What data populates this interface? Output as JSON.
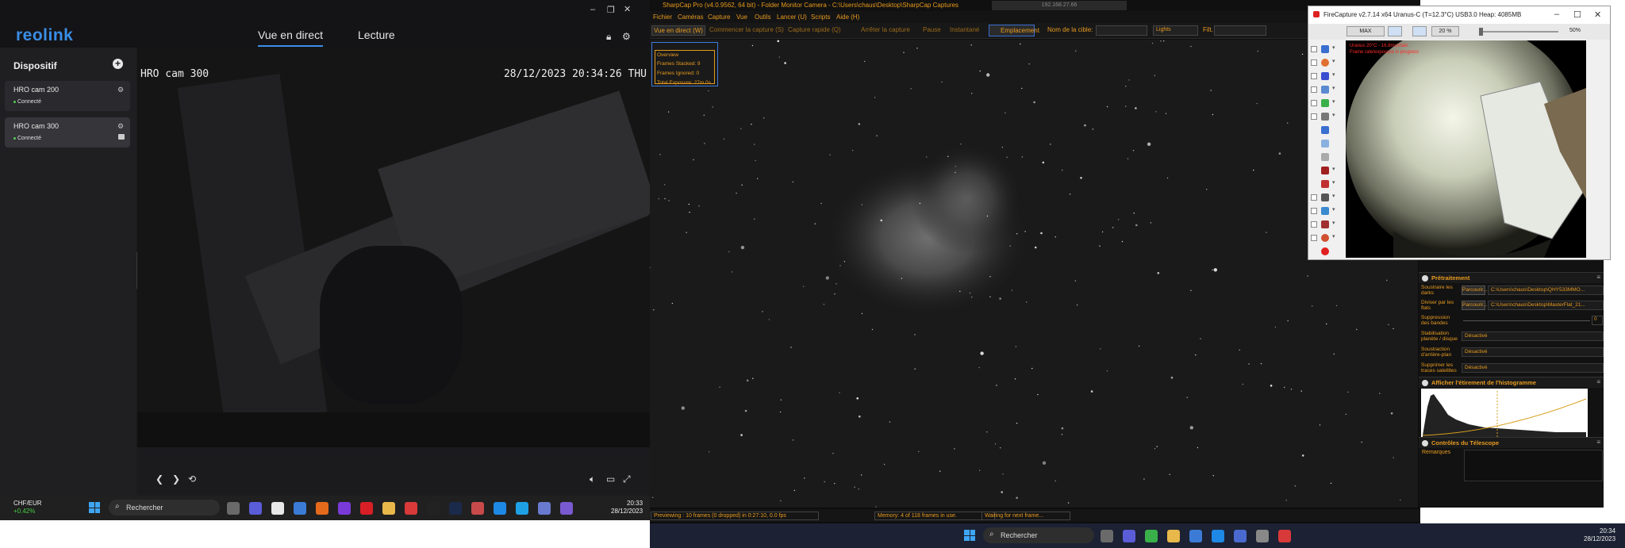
{
  "reolink": {
    "tabs": [
      "Vue en direct",
      "Lecture"
    ],
    "sidebar_title": "Dispositif",
    "cameras": [
      {
        "name": "HRO cam 200",
        "status": "Connecté"
      },
      {
        "name": "HRO cam 300",
        "status": "Connecté"
      }
    ],
    "osd_name": "HRO cam 300",
    "osd_time": "28/12/2023 20:34:26 THU",
    "accent": "#3a8de6"
  },
  "taskbar_left": {
    "ticker_symbol": "CHF/EUR",
    "ticker_change": "+0.42%",
    "search": "Rechercher",
    "time": "20:33",
    "date": "28/12/2023"
  },
  "sharpcap": {
    "title": "SharpCap Pro (v4.0.9562, 64 bit) - Folder Monitor Camera - C:\\Users\\chaus\\Desktop\\SharpCap Captures",
    "menu": [
      "Fichier",
      "Caméras",
      "Capture",
      "Vue",
      "Outils",
      "Lancer (U)",
      "Scripts",
      "Aide (H)"
    ],
    "toolbar": {
      "live": "Vue en direct (W)",
      "start": "Commencer la capture (S)",
      "quick": "Capture rapide (Q)",
      "stop": "Arrêter la capture",
      "pause": "Pause",
      "snapshot": "Instantané",
      "location": "Emplacement",
      "target_label": "Nom de la cible:",
      "type_value": "Lights",
      "filter_label": "Filt.",
      "ip": "192.168.27.66"
    },
    "overview": {
      "title": "Overview",
      "stacked": "Frames Stacked: 9",
      "ignored": "Frames Ignored: 0",
      "exposure": "Total Exposure:   27m 0s"
    },
    "status": {
      "preview": "Previewing : 10 frames (0 dropped) in 0:27:10, 0.0 fps",
      "memory": "Memory: 4 of 118 frames in use.",
      "waiting": "Waiting for next frame..."
    },
    "panel": {
      "preprocess_title": "Prétraitement",
      "dark_label": "Soustraire les darks",
      "dark_btn": "Parcourir...",
      "dark_path": "C:\\Users\\chaus\\Desktop\\QHY533MMO...",
      "flat_label": "Diviser par les flats",
      "flat_btn": "Parcourir...",
      "flat_path": "C:\\Users\\chaus\\Desktop\\MasterFlat_21...",
      "banding_label": "Suppression des bandes",
      "banding_value": "0",
      "stab_label": "Stabilisation planète / disque",
      "stab_value": "Désactivé",
      "bg_label": "Soustraction d'arrière-plan",
      "bg_value": "Désactivé",
      "sat_label": "Supprimer les traces satellites",
      "sat_value": "Désactivé",
      "histo_title": "Afficher l'étirement de l'histogramme",
      "scope_title": "Contrôles du Télescope",
      "notes_label": "Remarques"
    }
  },
  "firecapture": {
    "title": "FireCapture v2.7.14 x64    Uranus-C (T=12.3°C) USB3.0    Heap: 4085MB",
    "max_btn": "MAX",
    "zoom": "20 %",
    "zoom_right": "50%",
    "overlay1": "Uranus 20°C - 16.8ms/Gain",
    "overlay2": "Frame rate/exposure in progress"
  },
  "taskbar_right": {
    "search": "Rechercher",
    "time": "20:34",
    "date": "28/12/2023"
  }
}
